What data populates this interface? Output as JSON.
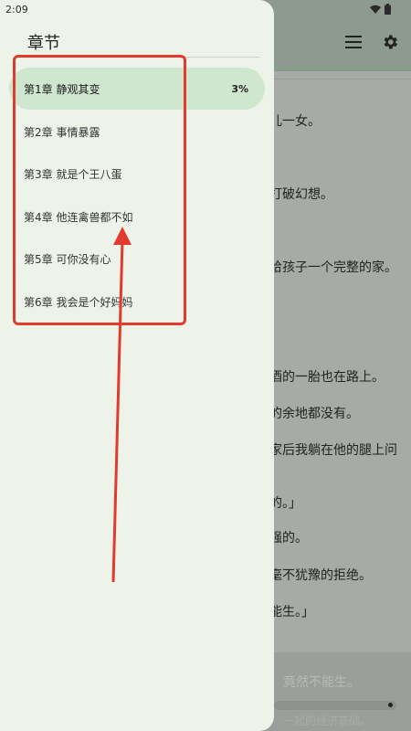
{
  "status": {
    "time": "2:09"
  },
  "drawer": {
    "title": "章节",
    "chapters": [
      {
        "label": "第1章 静观其变",
        "progress": "3%"
      },
      {
        "label": "第2章 事情暴露"
      },
      {
        "label": "第3章 就是个王八蛋"
      },
      {
        "label": "第4章 他连禽兽都不如"
      },
      {
        "label": "第5章 可你没有心"
      },
      {
        "label": "第6章 我会是个好妈妈"
      }
    ]
  },
  "reader": {
    "lines": [
      "儿一女。",
      "打破幻想。",
      "给孩子一个完整的家。",
      "，",
      "酒的一胎也在路上。",
      "的余地都没有。",
      "家后我躺在他的腿上问",
      "的。」",
      "强的。",
      "毫不犹豫的拒绝。",
      "能生。」"
    ],
    "bottom_hint": "竟然不能生。",
    "bottom_sub": "一起的经济基础。"
  },
  "colors": {
    "accent": "#cfe6cf",
    "annotation": "#e23b2e"
  }
}
